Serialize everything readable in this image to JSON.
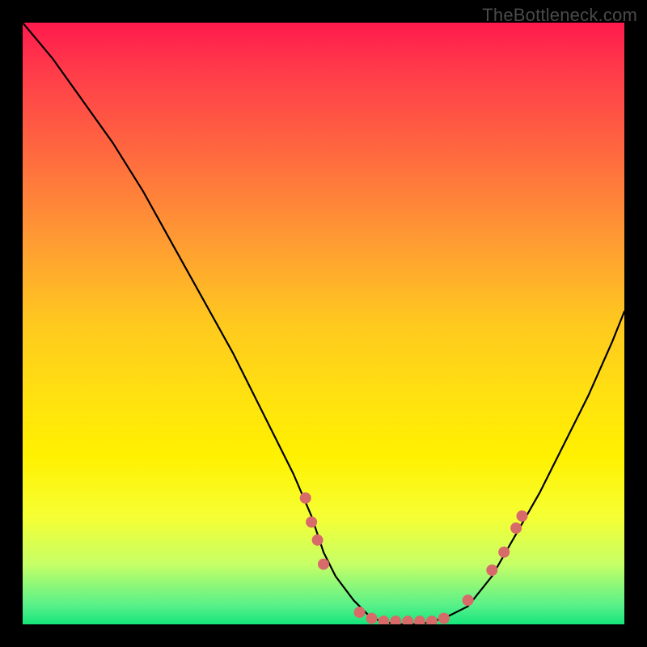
{
  "watermark": "TheBottleneck.com",
  "colors": {
    "background_frame": "#000000",
    "gradient_top": "#ff1a4d",
    "gradient_bottom": "#15e57a",
    "curve_stroke": "#000000",
    "marker_fill": "#d86a6a"
  },
  "chart_data": {
    "type": "line",
    "title": "",
    "xlabel": "",
    "ylabel": "",
    "xlim": [
      0,
      100
    ],
    "ylim": [
      0,
      100
    ],
    "series": [
      {
        "name": "bottleneck-curve",
        "x": [
          0,
          5,
          10,
          15,
          20,
          25,
          30,
          35,
          40,
          45,
          48,
          50,
          52,
          55,
          58,
          62,
          66,
          70,
          74,
          78,
          82,
          86,
          90,
          94,
          98,
          100
        ],
        "y": [
          100,
          94,
          87,
          80,
          72,
          63,
          54,
          45,
          35,
          25,
          18,
          12,
          8,
          4,
          1,
          0,
          0,
          1,
          3,
          8,
          15,
          22,
          30,
          38,
          47,
          52
        ]
      }
    ],
    "markers": [
      {
        "x": 47,
        "y": 21
      },
      {
        "x": 48,
        "y": 17
      },
      {
        "x": 49,
        "y": 14
      },
      {
        "x": 50,
        "y": 10
      },
      {
        "x": 56,
        "y": 2
      },
      {
        "x": 58,
        "y": 1
      },
      {
        "x": 60,
        "y": 0.5
      },
      {
        "x": 62,
        "y": 0.5
      },
      {
        "x": 64,
        "y": 0.5
      },
      {
        "x": 66,
        "y": 0.5
      },
      {
        "x": 68,
        "y": 0.5
      },
      {
        "x": 70,
        "y": 1
      },
      {
        "x": 74,
        "y": 4
      },
      {
        "x": 78,
        "y": 9
      },
      {
        "x": 80,
        "y": 12
      },
      {
        "x": 82,
        "y": 16
      },
      {
        "x": 83,
        "y": 18
      }
    ],
    "notes": "Axes are unitless/unlabeled in the original image; values estimated on a 0–100 normalized scale. y=0 at bottom (green), y=100 at top (red)."
  }
}
